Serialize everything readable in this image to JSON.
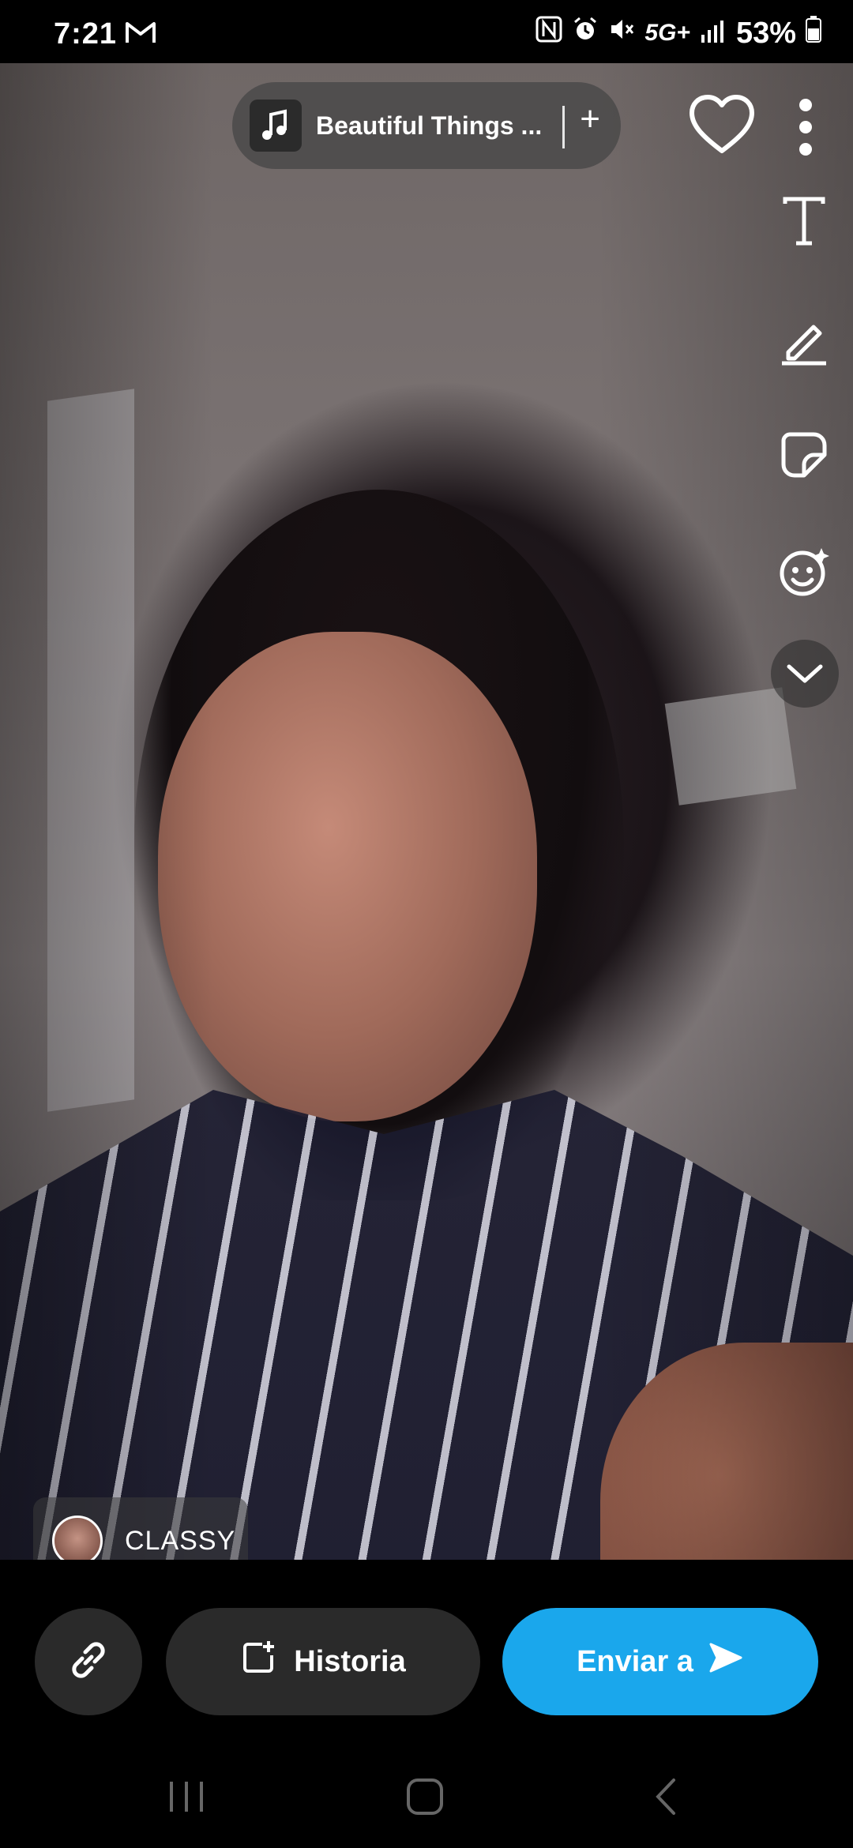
{
  "status_bar": {
    "time": "7:21",
    "network": "5G+",
    "battery": "53%"
  },
  "music_chip": {
    "title": "Beautiful Things ...",
    "plus": "+"
  },
  "lens": {
    "label": "CLASSY"
  },
  "actions": {
    "story_label": "Historia",
    "send_label": "Enviar a"
  },
  "colors": {
    "send_button": "#1aa7ec",
    "pill_bg": "#2a2a2a"
  },
  "icons": {
    "status": [
      "gmail-icon",
      "nfc-icon",
      "alarm-icon",
      "mute-icon",
      "signal-icon",
      "battery-icon"
    ],
    "toolbar": [
      "text-tool-icon",
      "pen-tool-icon",
      "sticker-tool-icon",
      "emoji-tool-icon",
      "chevron-down-icon"
    ]
  }
}
